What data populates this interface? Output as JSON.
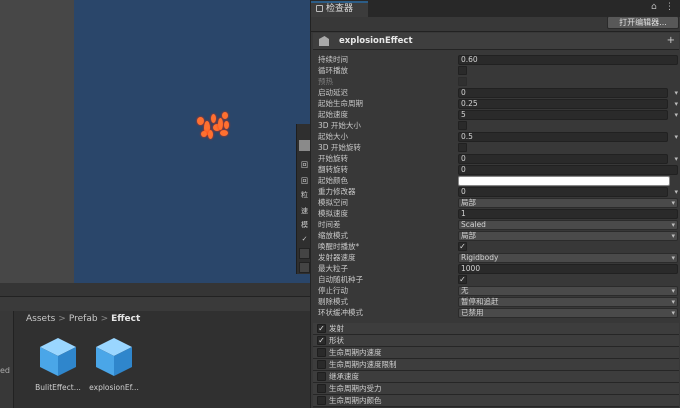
{
  "inspector": {
    "tab_label": "检查器",
    "lock_icon": "lock-icon",
    "menu_icon": "kebab-menu-icon",
    "open_editor_label": "打开编辑器...",
    "component": {
      "name": "explosionEffect",
      "add_symbol": "+"
    },
    "fields": [
      {
        "label": "持续时间",
        "value": "0.60",
        "kind": "text"
      },
      {
        "label": "循环播放",
        "value": "",
        "kind": "check"
      },
      {
        "label": "预热",
        "value": "",
        "kind": "check-dim"
      },
      {
        "label": "启动延迟",
        "value": "0",
        "kind": "curve"
      },
      {
        "label": "起始生命周期",
        "value": "0.25",
        "kind": "curve"
      },
      {
        "label": "起始速度",
        "value": "5",
        "kind": "curve"
      },
      {
        "label": "3D 开始大小",
        "value": "",
        "kind": "check"
      },
      {
        "label": "起始大小",
        "value": "0.5",
        "kind": "curve"
      },
      {
        "label": "3D 开始旋转",
        "value": "",
        "kind": "check"
      },
      {
        "label": "开始旋转",
        "value": "0",
        "kind": "curve"
      },
      {
        "label": "翻转旋转",
        "value": "0",
        "kind": "text"
      },
      {
        "label": "起始颜色",
        "value": "",
        "kind": "color"
      },
      {
        "label": "重力修改器",
        "value": "0",
        "kind": "curve"
      },
      {
        "label": "模拟空间",
        "value": "局部",
        "kind": "dropdown"
      },
      {
        "label": "模拟速度",
        "value": "1",
        "kind": "text"
      },
      {
        "label": "时间差",
        "value": "Scaled",
        "kind": "dropdown"
      },
      {
        "label": "缩放模式",
        "value": "局部",
        "kind": "dropdown"
      },
      {
        "label": "唤醒时播放*",
        "value": "✓",
        "kind": "check"
      },
      {
        "label": "发射器速度",
        "value": "Rigidbody",
        "kind": "dropdown"
      },
      {
        "label": "最大粒子",
        "value": "1000",
        "kind": "text"
      },
      {
        "label": "自动随机种子",
        "value": "✓",
        "kind": "check"
      },
      {
        "label": "停止行动",
        "value": "无",
        "kind": "dropdown"
      },
      {
        "label": "剔除模式",
        "value": "暂停和追赶",
        "kind": "dropdown"
      },
      {
        "label": "环状缓冲模式",
        "value": "已禁用",
        "kind": "dropdown"
      }
    ],
    "modules": [
      {
        "label": "发射",
        "checked": "✓"
      },
      {
        "label": "形状",
        "checked": "✓"
      },
      {
        "label": "生命周期内速度",
        "checked": ""
      },
      {
        "label": "生命周期内速度限制",
        "checked": ""
      },
      {
        "label": "继承速度",
        "checked": ""
      },
      {
        "label": "生命周期内受力",
        "checked": ""
      },
      {
        "label": "生命周期内颜色",
        "checked": ""
      }
    ]
  },
  "scene": {
    "strip_items": [
      "",
      "回",
      "回",
      "粒",
      "速",
      "模",
      "✓",
      "",
      ""
    ]
  },
  "project": {
    "breadcrumb": [
      "Assets",
      "Prefab",
      "Effect"
    ],
    "assets": [
      {
        "name": "BulitEffect...",
        "icon": "prefab-cube-icon"
      },
      {
        "name": "explosionEf...",
        "icon": "prefab-cube-icon"
      }
    ],
    "side_label": "ed"
  },
  "colors": {
    "scene_bg": "#2a466a",
    "accent_tab": "#2c5d87",
    "prefab_blue": "#5fb4f0",
    "particle": "#ff7030"
  }
}
